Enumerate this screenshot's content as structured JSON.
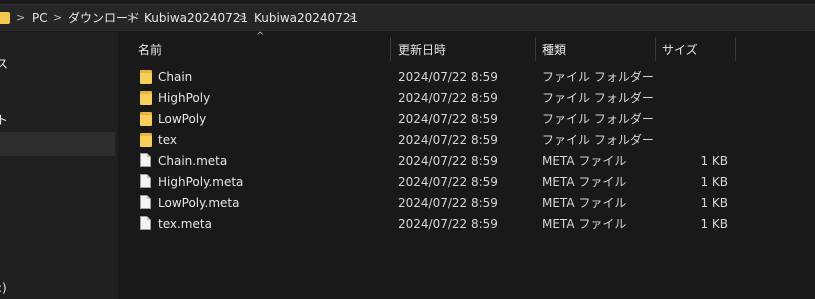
{
  "breadcrumb": {
    "items": [
      "PC",
      "ダウンロード",
      "Kubiwa20240721",
      "Kubiwa20240721"
    ],
    "separator": ">"
  },
  "nav": {
    "items": [
      "ス",
      "ト",
      ":)"
    ]
  },
  "columns": {
    "name": "名前",
    "modified": "更新日時",
    "type": "種類",
    "size": "サイズ",
    "sort_arrow": "^"
  },
  "files": [
    {
      "name": "Chain",
      "modified": "2024/07/22 8:59",
      "type": "ファイル フォルダー",
      "size": "",
      "kind": "folder"
    },
    {
      "name": "HighPoly",
      "modified": "2024/07/22 8:59",
      "type": "ファイル フォルダー",
      "size": "",
      "kind": "folder"
    },
    {
      "name": "LowPoly",
      "modified": "2024/07/22 8:59",
      "type": "ファイル フォルダー",
      "size": "",
      "kind": "folder"
    },
    {
      "name": "tex",
      "modified": "2024/07/22 8:59",
      "type": "ファイル フォルダー",
      "size": "",
      "kind": "folder"
    },
    {
      "name": "Chain.meta",
      "modified": "2024/07/22 8:59",
      "type": "META ファイル",
      "size": "1 KB",
      "kind": "file"
    },
    {
      "name": "HighPoly.meta",
      "modified": "2024/07/22 8:59",
      "type": "META ファイル",
      "size": "1 KB",
      "kind": "file"
    },
    {
      "name": "LowPoly.meta",
      "modified": "2024/07/22 8:59",
      "type": "META ファイル",
      "size": "1 KB",
      "kind": "file"
    },
    {
      "name": "tex.meta",
      "modified": "2024/07/22 8:59",
      "type": "META ファイル",
      "size": "1 KB",
      "kind": "file"
    }
  ],
  "colors": {
    "background": "#191919",
    "folder": "#f6cf5a"
  }
}
